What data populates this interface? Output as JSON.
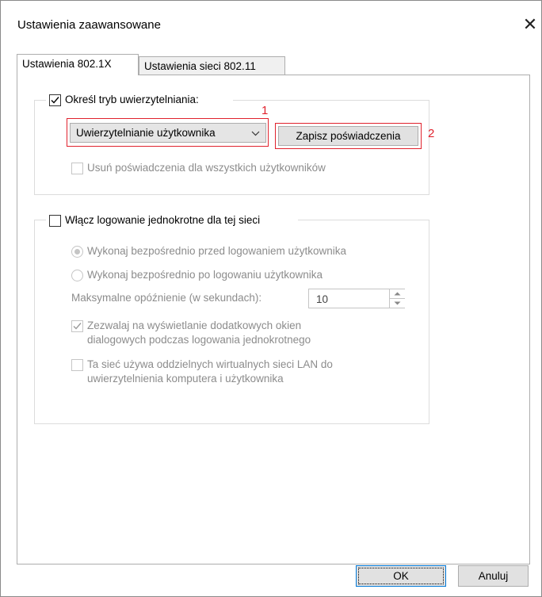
{
  "window": {
    "title": "Ustawienia zaawansowane"
  },
  "tabs": [
    {
      "label": "Ustawienia 802.1X",
      "active": true
    },
    {
      "label": "Ustawienia sieci 802.11",
      "active": false
    }
  ],
  "auth": {
    "checkbox_label": "Określ tryb uwierzytelniania:",
    "checked": true,
    "mode_value": "Uwierzytelnianie użytkownika",
    "save_button": "Zapisz poświadczenia",
    "delete_creds_label": "Usuń poświadczenia dla wszystkich użytkowników",
    "annotation_1": "1",
    "annotation_2": "2"
  },
  "sso": {
    "checkbox_label": "Włącz logowanie jednokrotne dla tej sieci",
    "checked": false,
    "radio_before": "Wykonaj bezpośrednio przed logowaniem użytkownika",
    "radio_after": "Wykonaj bezpośrednio po logowaniu użytkownika",
    "delay_label": "Maksymalne opóźnienie (w sekundach):",
    "delay_value": "10",
    "allow_dialogs_line1": "Zezwalaj na wyświetlanie dodatkowych okien",
    "allow_dialogs_line2": "dialogowych podczas logowania jednokrotnego",
    "vlan_line1": "Ta sieć używa oddzielnych wirtualnych sieci LAN do",
    "vlan_line2": "uwierzytelnienia komputera i użytkownika"
  },
  "footer": {
    "ok": "OK",
    "cancel": "Anuluj"
  },
  "colors": {
    "annotation": "#e0222d",
    "focus_border": "#0078d7"
  }
}
